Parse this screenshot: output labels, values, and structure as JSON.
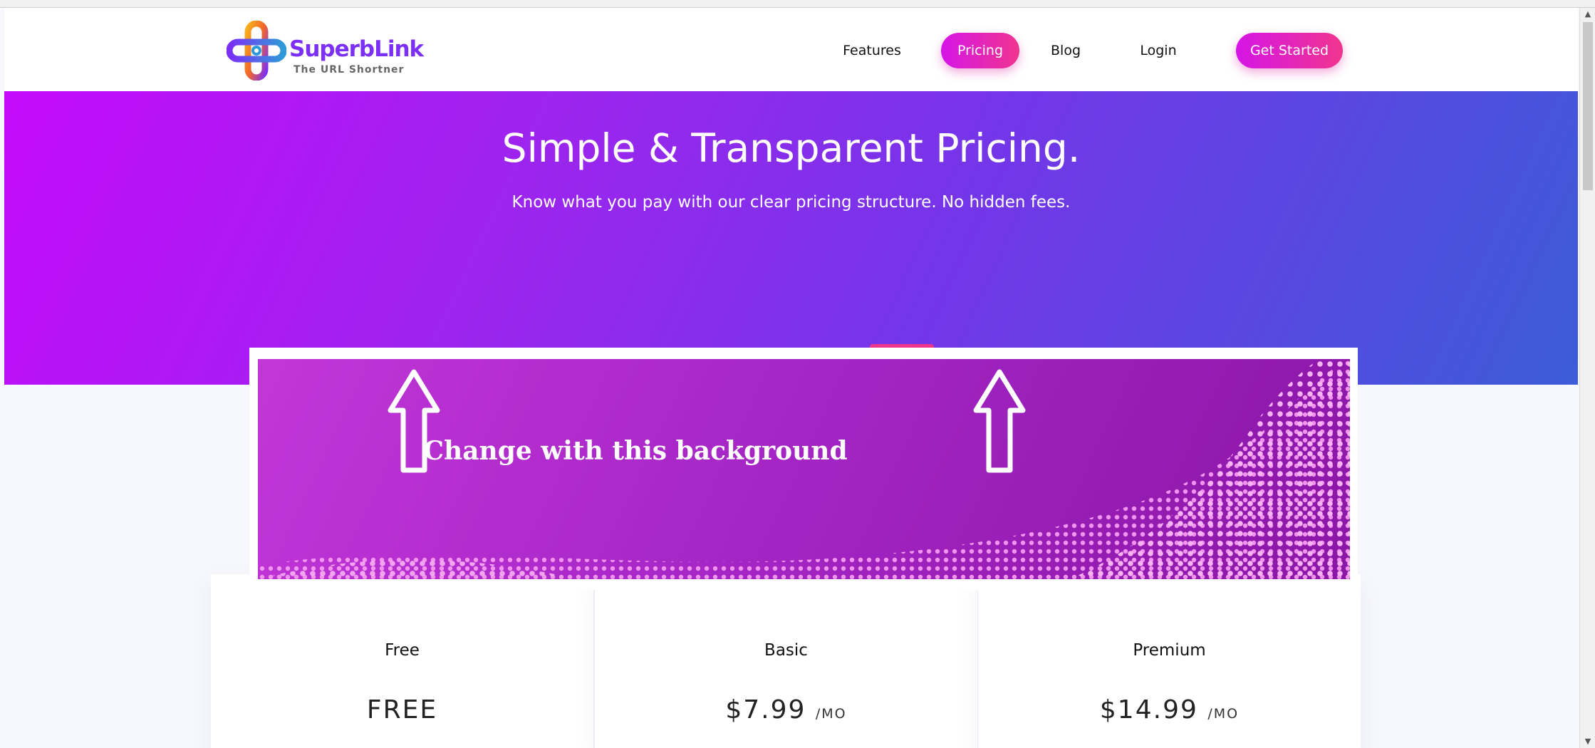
{
  "brand": {
    "name": "SuperbLink",
    "tagline": "The URL Shortner"
  },
  "nav": {
    "features": "Features",
    "pricing": "Pricing",
    "blog": "Blog",
    "login": "Login",
    "get_started": "Get Started"
  },
  "hero": {
    "title": "Simple & Transparent Pricing.",
    "subtitle": "Know what you pay with our clear pricing structure. No hidden fees."
  },
  "annotation": {
    "text": "Change with this background"
  },
  "plans": [
    {
      "name": "Free",
      "price": "FREE",
      "unit": ""
    },
    {
      "name": "Basic",
      "price": "$7.99",
      "unit": "/MO"
    },
    {
      "name": "Premium",
      "price": "$14.99",
      "unit": "/MO"
    }
  ],
  "colors": {
    "accent_pink": "#f0358f",
    "accent_purple": "#c40afa",
    "hero_blue": "#3b5cd8"
  },
  "icons": {
    "scroll_up": "▲",
    "scroll_down": "▼"
  }
}
